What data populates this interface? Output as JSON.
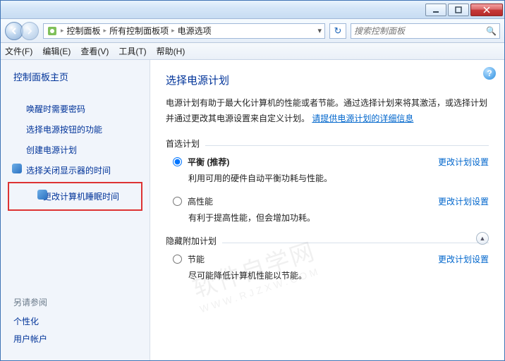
{
  "titlebar": {
    "min_tooltip": "最小化",
    "max_tooltip": "最大化",
    "close_tooltip": "关闭"
  },
  "nav": {
    "crumb1": "控制面板",
    "crumb2": "所有控制面板项",
    "crumb3": "电源选项",
    "search_placeholder": "搜索控制面板"
  },
  "menus": {
    "file": "文件(F)",
    "edit": "编辑(E)",
    "view": "查看(V)",
    "tools": "工具(T)",
    "help": "帮助(H)"
  },
  "sidebar": {
    "home": "控制面板主页",
    "items": [
      "唤醒时需要密码",
      "选择电源按钮的功能",
      "创建电源计划",
      "选择关闭显示器的时间",
      "更改计算机睡眠时间"
    ],
    "see_also": "另请参阅",
    "personalize": "个性化",
    "user_accounts": "用户帐户"
  },
  "content": {
    "heading": "选择电源计划",
    "desc_pre": "电源计划有助于最大化计算机的性能或者节能。通过选择计划来将其激活，或选择计划并通过更改其电源设置来自定义计划。",
    "desc_link": "请提供电源计划的详细信息",
    "preferred": "首选计划",
    "hidden_label": "隐藏附加计划",
    "change_link": "更改计划设置",
    "plans": [
      {
        "name": "平衡 (推荐)",
        "sub": "利用可用的硬件自动平衡功耗与性能。",
        "checked": true
      },
      {
        "name": "高性能",
        "sub": "有利于提高性能，但会增加功耗。",
        "checked": false
      }
    ],
    "extra_plans": [
      {
        "name": "节能",
        "sub": "尽可能降低计算机性能以节能。",
        "checked": false
      }
    ]
  },
  "watermark": {
    "big": "软件自学网",
    "small": "WWW.RJZXW.COM"
  }
}
